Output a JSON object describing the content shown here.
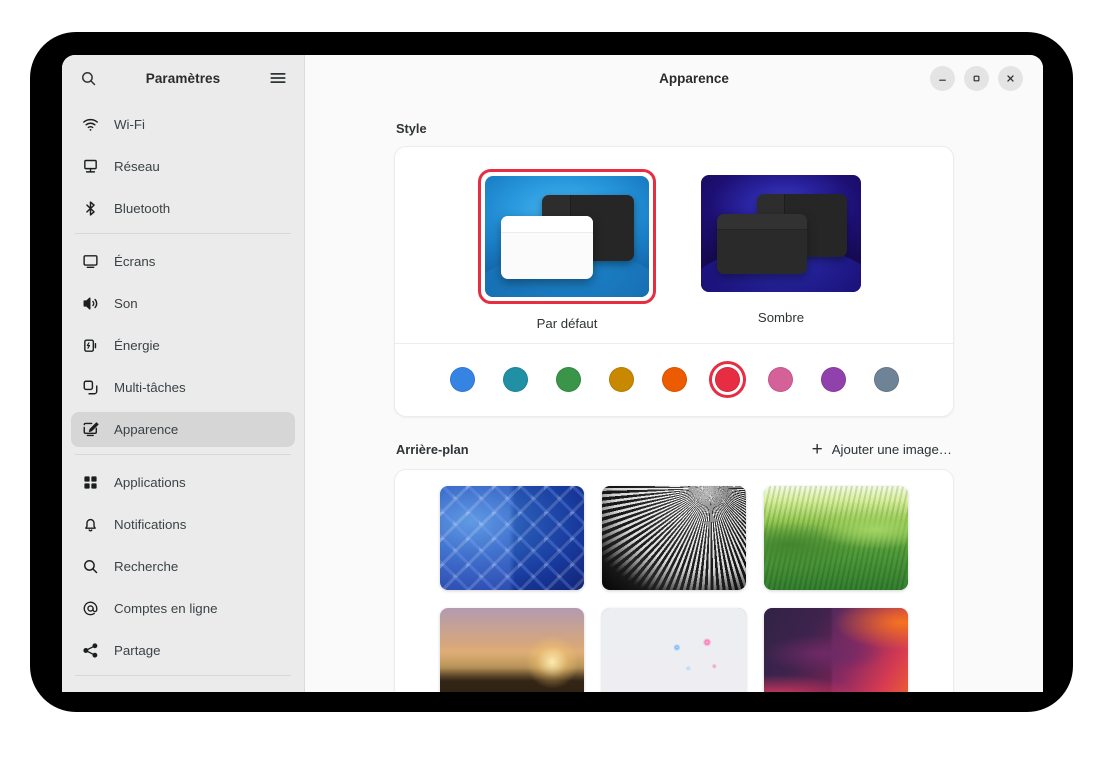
{
  "window": {
    "sidebar_title": "Paramètres",
    "main_title": "Apparence",
    "search_icon": "search-icon",
    "menu_icon": "hamburger-menu-icon",
    "controls": {
      "minimize": "minimize-icon",
      "maximize": "maximize-icon",
      "close": "close-icon"
    }
  },
  "sidebar": {
    "groups": [
      {
        "items": [
          {
            "label": "Wi-Fi",
            "icon": "wifi-icon",
            "selected": false
          },
          {
            "label": "Réseau",
            "icon": "network-icon",
            "selected": false
          },
          {
            "label": "Bluetooth",
            "icon": "bluetooth-icon",
            "selected": false
          }
        ]
      },
      {
        "items": [
          {
            "label": "Écrans",
            "icon": "display-icon",
            "selected": false
          },
          {
            "label": "Son",
            "icon": "sound-icon",
            "selected": false
          },
          {
            "label": "Énergie",
            "icon": "power-icon",
            "selected": false
          },
          {
            "label": "Multi-tâches",
            "icon": "multitasking-icon",
            "selected": false
          },
          {
            "label": "Apparence",
            "icon": "appearance-icon",
            "selected": true
          }
        ]
      },
      {
        "items": [
          {
            "label": "Applications",
            "icon": "applications-icon",
            "selected": false
          },
          {
            "label": "Notifications",
            "icon": "bell-icon",
            "selected": false
          },
          {
            "label": "Recherche",
            "icon": "search-icon",
            "selected": false
          },
          {
            "label": "Comptes en ligne",
            "icon": "at-sign-icon",
            "selected": false
          },
          {
            "label": "Partage",
            "icon": "share-icon",
            "selected": false
          }
        ]
      }
    ]
  },
  "style_section": {
    "title": "Style",
    "options": [
      {
        "label": "Par défaut",
        "variant": "light",
        "selected": true
      },
      {
        "label": "Sombre",
        "variant": "dark",
        "selected": false
      }
    ],
    "accent_colors": [
      {
        "name": "blue",
        "hex": "#3584e4",
        "selected": false
      },
      {
        "name": "teal",
        "hex": "#2190a4",
        "selected": false
      },
      {
        "name": "green",
        "hex": "#3a944a",
        "selected": false
      },
      {
        "name": "yellow",
        "hex": "#c88800",
        "selected": false
      },
      {
        "name": "orange",
        "hex": "#ed5b00",
        "selected": false
      },
      {
        "name": "red",
        "hex": "#e62d42",
        "selected": true
      },
      {
        "name": "pink",
        "hex": "#d56199",
        "selected": false
      },
      {
        "name": "purple",
        "hex": "#9141ac",
        "selected": false
      },
      {
        "name": "slate",
        "hex": "#6f8396",
        "selected": false
      }
    ],
    "selection_ring_color": "#e62d42"
  },
  "background_section": {
    "title": "Arrière-plan",
    "add_button_label": "Ajouter une image…",
    "add_button_icon": "plus-icon",
    "wallpapers": [
      {
        "name": "blue-geometric-triangles",
        "art": "w-geo"
      },
      {
        "name": "black-white-spiral",
        "art": "w-spiral"
      },
      {
        "name": "green-tea-hills",
        "art": "w-hills"
      },
      {
        "name": "city-sunset-skyline",
        "art": "w-city"
      },
      {
        "name": "fireworks-night-sky",
        "art": "w-fire"
      },
      {
        "name": "abstract-magenta-waves",
        "art": "w-wave"
      }
    ]
  }
}
